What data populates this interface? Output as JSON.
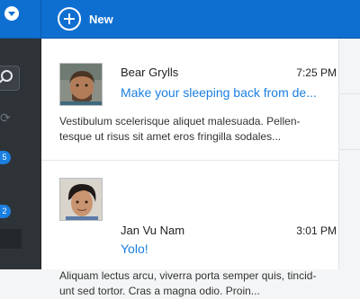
{
  "toolbar": {
    "new_label": "New"
  },
  "sidebar": {
    "badges": [
      {
        "count": "5"
      },
      {
        "count": "2"
      }
    ]
  },
  "messages": [
    {
      "sender": "Bear Grylls",
      "time": "7:25 PM",
      "subject": "Make your sleeping back from de...",
      "preview_line1": "Vestibulum scelerisque aliquet malesuada. Pellen-",
      "preview_line2": "tesque ut risus sit amet eros fringilla sodales..."
    },
    {
      "sender": "Jan Vu Nam",
      "time": "3:01 PM",
      "subject": "Yolo!",
      "preview_line1": "Aliquam lectus arcu, viverra porta semper quis, tincid-",
      "preview_line2": "unt sed tortor. Cras a magna odio. Proin..."
    }
  ],
  "colors": {
    "accent": "#0f6fd1",
    "link": "#1a7fe0",
    "sidebar": "#2e3338"
  }
}
